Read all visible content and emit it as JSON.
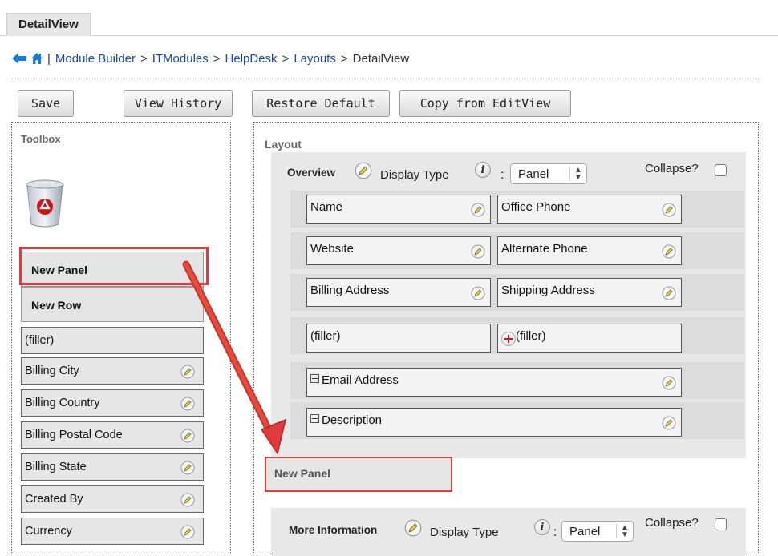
{
  "tab": {
    "label": "DetailView"
  },
  "breadcrumb": {
    "separator": "|",
    "items": [
      "Module Builder",
      "ITModules",
      "HelpDesk",
      "Layouts"
    ],
    "current": "DetailView",
    "arrow": ">"
  },
  "toolbar": {
    "save": "Save",
    "view_history": "View History",
    "restore_default": "Restore Default",
    "copy_from_editview": "Copy from EditView"
  },
  "toolbox": {
    "title": "Toolbox",
    "new_panel": "New Panel",
    "new_row": "New Row",
    "filler": "(filler)",
    "fields": [
      "Billing City",
      "Billing Country",
      "Billing Postal Code",
      "Billing State",
      "Created By",
      "Currency"
    ]
  },
  "layout": {
    "title": "Layout",
    "overview": {
      "title": "Overview",
      "display_type_label": "Display Type",
      "display_type_value": "Panel",
      "collapse_label": "Collapse?",
      "rows": [
        {
          "left": "Name",
          "right": "Office Phone"
        },
        {
          "left": "Website",
          "right": "Alternate Phone"
        },
        {
          "left": "Billing Address",
          "right": "Shipping Address"
        },
        {
          "left": "(filler)",
          "right": "(filler)"
        }
      ],
      "wide_rows": [
        "Email Address",
        "Description"
      ]
    },
    "new_panel": "New Panel",
    "more_information": {
      "title": "More Information",
      "display_type_label": "Display Type",
      "display_type_value": "Panel",
      "collapse_label": "Collapse?"
    }
  },
  "colors": {
    "highlight": "#e0393e",
    "link": "#1a47a6"
  }
}
